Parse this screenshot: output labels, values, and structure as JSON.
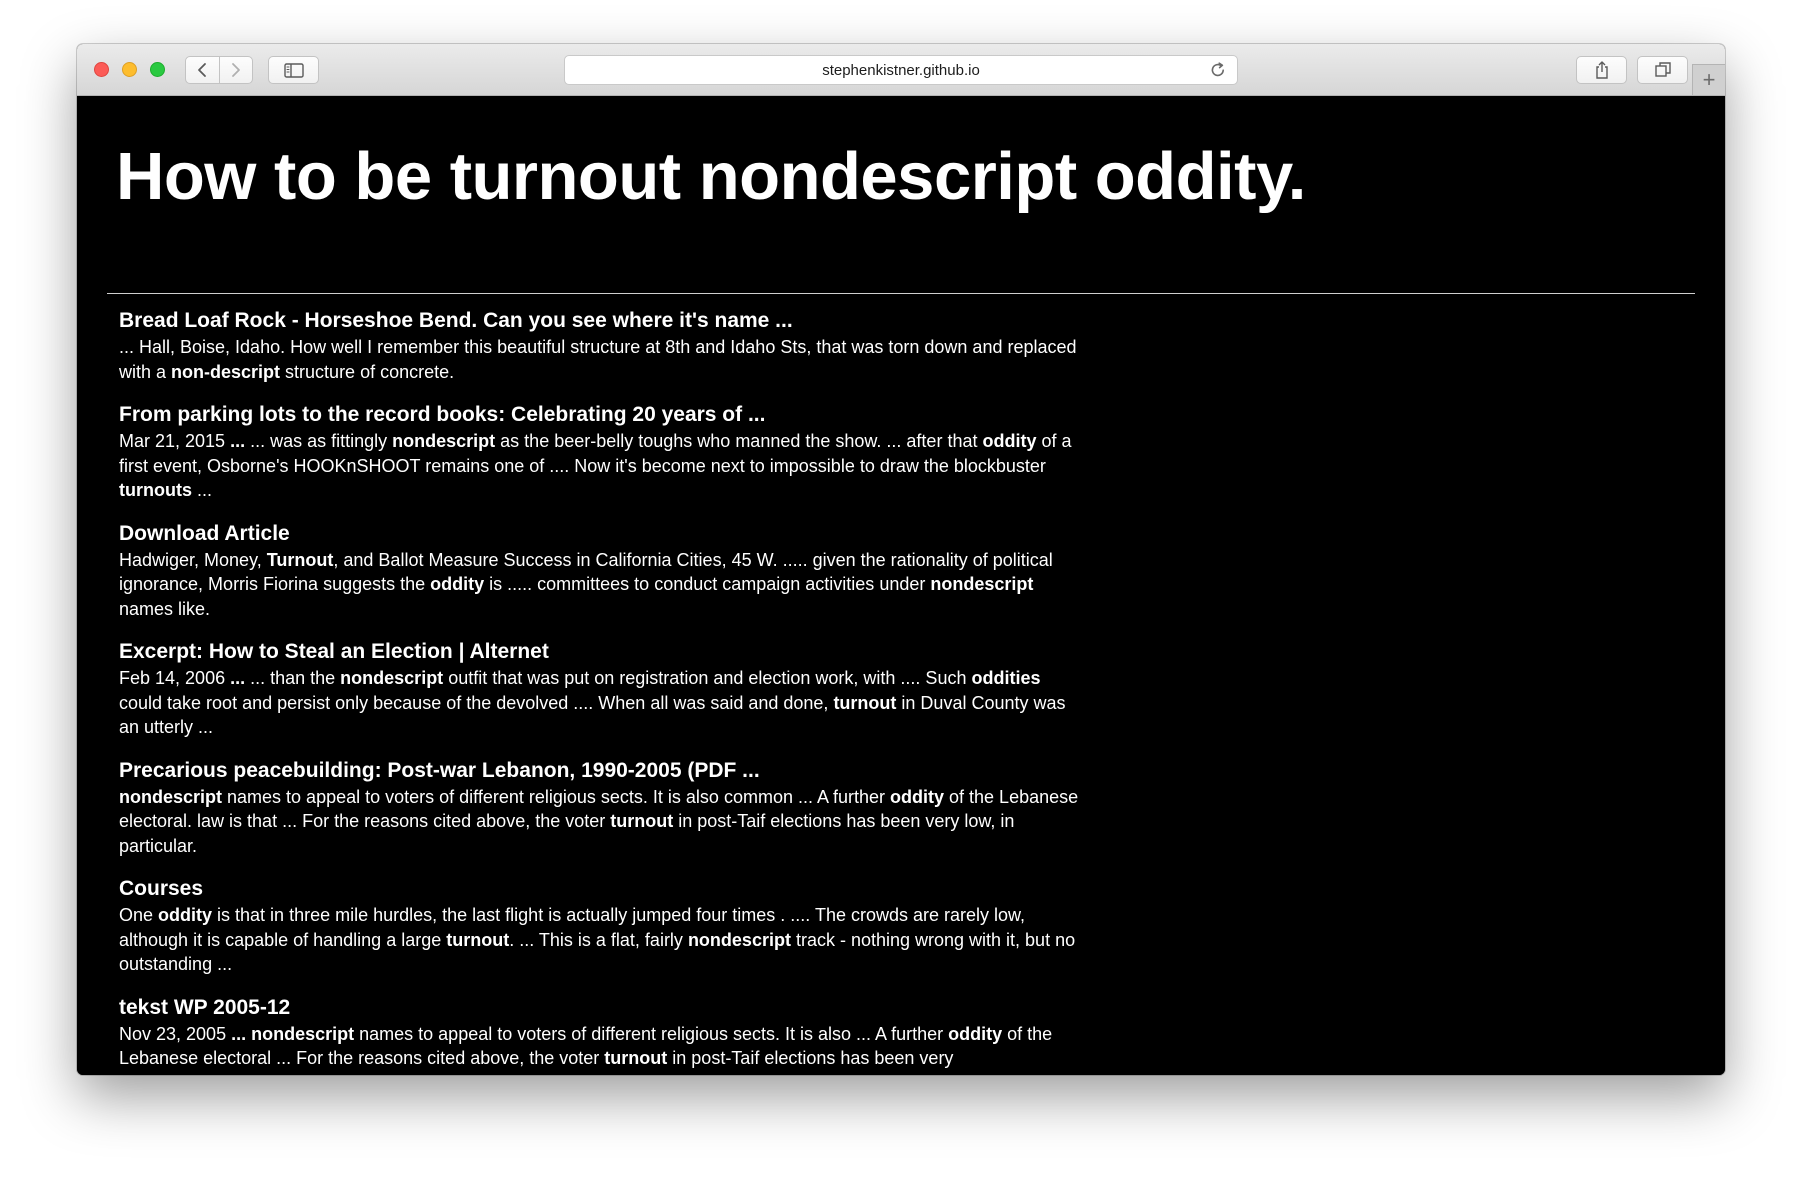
{
  "browser": {
    "url": "stephenkistner.github.io",
    "new_tab_label": "+"
  },
  "page": {
    "title": "How to be turnout nondescript oddity."
  },
  "results": [
    {
      "title": "Bread Loaf Rock - Horseshoe Bend. Can you see where it's name ...",
      "snippet": [
        {
          "t": "... Hall, Boise, Idaho. How well I remember this beautiful structure at 8th and Idaho Sts, that was torn down and replaced with a ",
          "b": false
        },
        {
          "t": "non-descript",
          "b": true
        },
        {
          "t": " structure of concrete.",
          "b": false
        }
      ]
    },
    {
      "title": "From parking lots to the record books: Celebrating 20 years of ...",
      "snippet": [
        {
          "t": "Mar 21, 2015 ",
          "b": false
        },
        {
          "t": "...",
          "b": true
        },
        {
          "t": " ... was as fittingly ",
          "b": false
        },
        {
          "t": "nondescript",
          "b": true
        },
        {
          "t": " as the beer-belly toughs who manned the show. ... after that ",
          "b": false
        },
        {
          "t": "oddity",
          "b": true
        },
        {
          "t": " of a first event, Osborne's HOOKnSHOOT remains one of .... Now it's become next to impossible to draw the blockbuster ",
          "b": false
        },
        {
          "t": "turnouts",
          "b": true
        },
        {
          "t": " ...",
          "b": false
        }
      ]
    },
    {
      "title": "Download Article",
      "snippet": [
        {
          "t": "Hadwiger, Money, ",
          "b": false
        },
        {
          "t": "Turnout",
          "b": true
        },
        {
          "t": ", and Ballot Measure Success in California Cities, 45 W. ..... given the rationality of political ignorance, Morris Fiorina suggests the ",
          "b": false
        },
        {
          "t": "oddity",
          "b": true
        },
        {
          "t": " is ..... committees to conduct campaign activities under ",
          "b": false
        },
        {
          "t": "nondescript",
          "b": true
        },
        {
          "t": " names like.",
          "b": false
        }
      ]
    },
    {
      "title": "Excerpt: How to Steal an Election | Alternet",
      "snippet": [
        {
          "t": "Feb 14, 2006 ",
          "b": false
        },
        {
          "t": "...",
          "b": true
        },
        {
          "t": " ... than the ",
          "b": false
        },
        {
          "t": "nondescript",
          "b": true
        },
        {
          "t": " outfit that was put on registration and election work, with .... Such ",
          "b": false
        },
        {
          "t": "oddities",
          "b": true
        },
        {
          "t": " could take root and persist only because of the devolved .... When all was said and done, ",
          "b": false
        },
        {
          "t": "turnout",
          "b": true
        },
        {
          "t": " in Duval County was an utterly ...",
          "b": false
        }
      ]
    },
    {
      "title": "Precarious peacebuilding: Post-war Lebanon, 1990-2005 (PDF ...",
      "snippet": [
        {
          "t": "nondescript",
          "b": true
        },
        {
          "t": " names to appeal to voters of different religious sects. It is also common ... A further ",
          "b": false
        },
        {
          "t": "oddity",
          "b": true
        },
        {
          "t": " of the Lebanese electoral. law is that ... For the reasons cited above, the voter ",
          "b": false
        },
        {
          "t": "turnout",
          "b": true
        },
        {
          "t": " in post-Taif elections has been very low, in particular.",
          "b": false
        }
      ]
    },
    {
      "title": "Courses",
      "snippet": [
        {
          "t": "One ",
          "b": false
        },
        {
          "t": "oddity",
          "b": true
        },
        {
          "t": " is that in three mile hurdles, the last flight is actually jumped four times . .... The crowds are rarely low, although it is capable of handling a large ",
          "b": false
        },
        {
          "t": "turnout",
          "b": true
        },
        {
          "t": ". ... This is a flat, fairly ",
          "b": false
        },
        {
          "t": "nondescript",
          "b": true
        },
        {
          "t": " track - nothing wrong with it, but no outstanding  ...",
          "b": false
        }
      ]
    },
    {
      "title": "tekst WP 2005-12",
      "snippet": [
        {
          "t": "Nov 23, 2005 ",
          "b": false
        },
        {
          "t": "...",
          "b": true
        },
        {
          "t": " ",
          "b": false
        },
        {
          "t": "nondescript",
          "b": true
        },
        {
          "t": " names to appeal to voters of different religious sects. It is also ... A further ",
          "b": false
        },
        {
          "t": "oddity",
          "b": true
        },
        {
          "t": " of the Lebanese electoral ... For the reasons cited above, the voter ",
          "b": false
        },
        {
          "t": "turnout",
          "b": true
        },
        {
          "t": " in post-Taif elections has been very",
          "b": false
        }
      ]
    }
  ]
}
